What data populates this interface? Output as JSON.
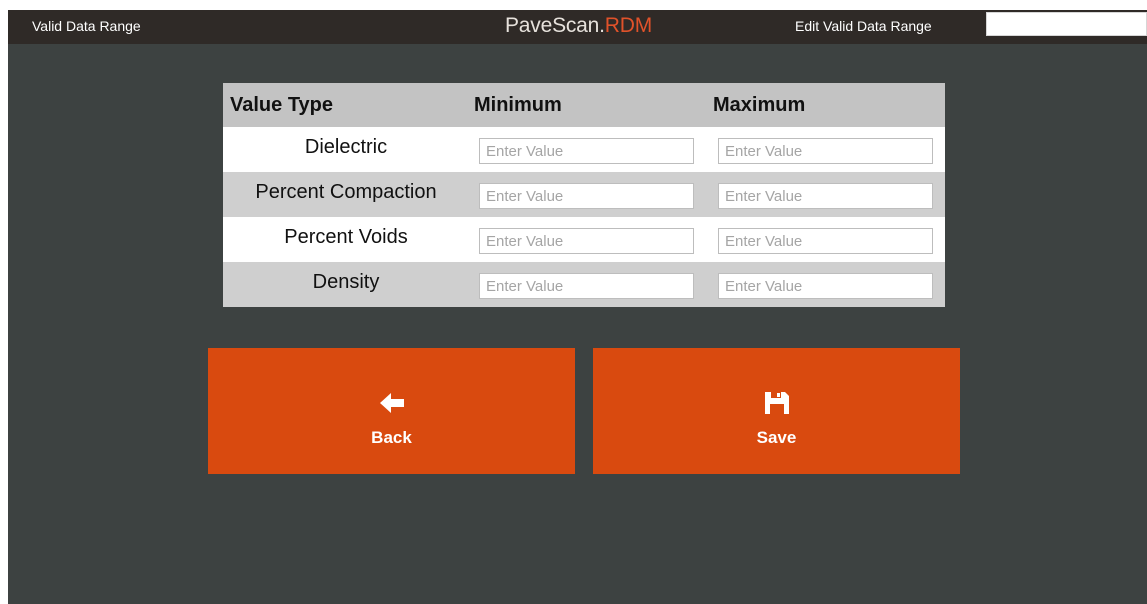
{
  "header": {
    "left_title": "Valid Data Range",
    "brand_main": "PaveScan",
    "brand_suffix": "RDM",
    "right_title": "Edit Valid Data Range",
    "search_value": ""
  },
  "table": {
    "columns": [
      "Value Type",
      "Minimum",
      "Maximum"
    ],
    "rows": [
      {
        "label": "Dielectric",
        "min_placeholder": "Enter Value",
        "max_placeholder": "Enter Value"
      },
      {
        "label": "Percent Compaction",
        "min_placeholder": "Enter Value",
        "max_placeholder": "Enter Value"
      },
      {
        "label": "Percent Voids",
        "min_placeholder": "Enter Value",
        "max_placeholder": "Enter Value"
      },
      {
        "label": "Density",
        "min_placeholder": "Enter Value",
        "max_placeholder": "Enter Value"
      }
    ]
  },
  "buttons": {
    "back": {
      "label": "Back",
      "icon": "arrow-left-icon"
    },
    "save": {
      "label": "Save",
      "icon": "floppy-disk-icon"
    }
  },
  "colors": {
    "background": "#3d4241",
    "topbar": "#2f2a27",
    "accent": "#d94a0f",
    "brand_suffix": "#e0522a"
  }
}
